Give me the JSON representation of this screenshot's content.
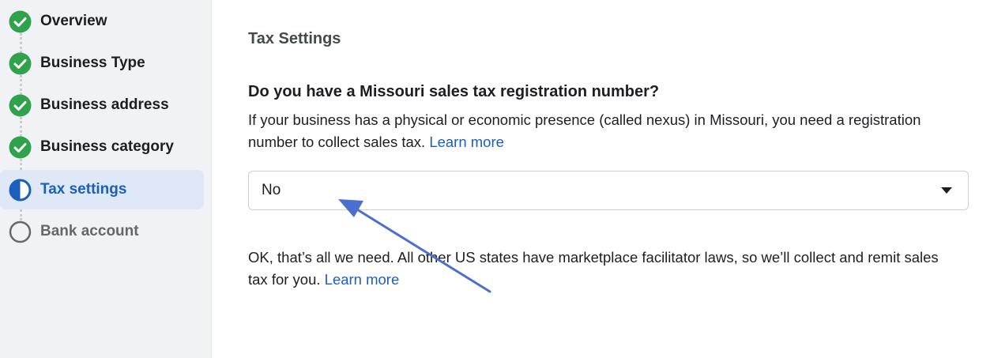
{
  "sidebar": {
    "steps": [
      {
        "label": "Overview",
        "status": "complete"
      },
      {
        "label": "Business Type",
        "status": "complete"
      },
      {
        "label": "Business address",
        "status": "complete"
      },
      {
        "label": "Business category",
        "status": "complete"
      },
      {
        "label": "Tax settings",
        "status": "in-progress"
      },
      {
        "label": "Bank account",
        "status": "pending"
      }
    ]
  },
  "main": {
    "section_title": "Tax Settings",
    "question": "Do you have a Missouri sales tax registration number?",
    "description": "If your business has a physical or economic presence (called nexus) in Missouri, you need a registration number to collect sales tax.",
    "description_link": "Learn more",
    "select_value": "No",
    "footer_text": "OK, that’s all we need. All other US states have marketplace facilitator laws, so we’ll collect and remit sales tax for you.",
    "footer_link": "Learn more"
  },
  "colors": {
    "complete": "#31a24c",
    "active": "#1b5fbd",
    "annotation_arrow": "#4a6fcf"
  },
  "icons": {
    "complete": "check-circle-icon",
    "in_progress": "half-circle-icon",
    "pending": "empty-circle-icon",
    "select": "caret-down-icon"
  }
}
